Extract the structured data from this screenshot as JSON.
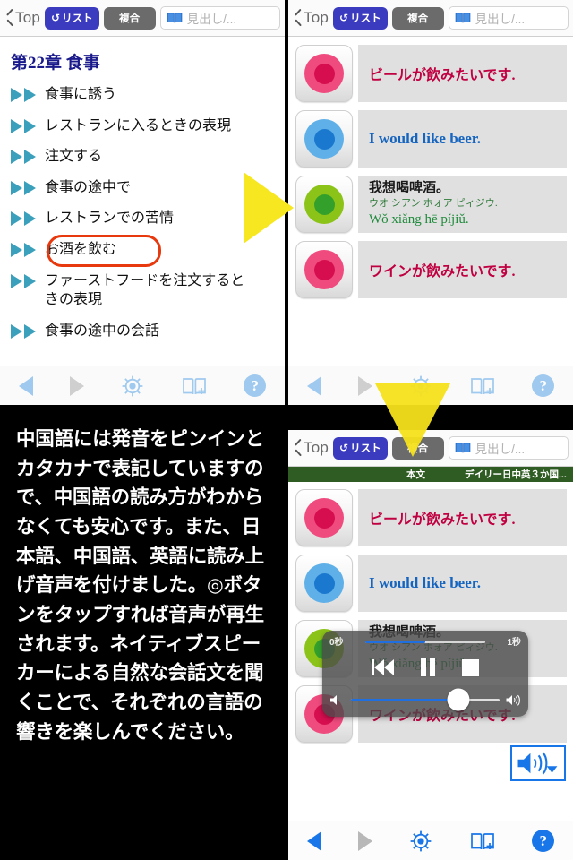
{
  "navbar": {
    "back_label": "Top",
    "list_button": "リスト",
    "list_icon": "loop-arrow-icon",
    "compound_button": "複合",
    "search_placeholder": "見出し/...",
    "search_icon": "open-book-icon",
    "back_icon": "chevron-left-icon"
  },
  "toc": {
    "title": "第22章 食事",
    "items": [
      {
        "label": "食事に誘う",
        "highlighted": false
      },
      {
        "label": "レストランに入るときの表現",
        "highlighted": false
      },
      {
        "label": "注文する",
        "highlighted": false
      },
      {
        "label": "食事の途中で",
        "highlighted": false
      },
      {
        "label": "レストランでの苦情",
        "highlighted": false
      },
      {
        "label": "お酒を飲む",
        "highlighted": true
      },
      {
        "label": "ファーストフードを注文すると\nきの表現",
        "highlighted": false
      },
      {
        "label": "食事の途中の会話",
        "highlighted": false
      }
    ],
    "highlight_color": "#e8380d"
  },
  "toolbar": {
    "back_icon": "back-triangle-icon",
    "forward_icon": "forward-triangle-icon",
    "wheel_icon": "ship-wheel-icon",
    "bookmark_icon": "book-plus-icon",
    "help_icon": "question-mark-icon",
    "help_label": "?"
  },
  "sentences": [
    {
      "button_icon": "play-audio-pink-icon",
      "color": "pink",
      "lang": "ja",
      "text": "ビールが飲みたいです."
    },
    {
      "button_icon": "play-audio-blue-icon",
      "color": "blue",
      "lang": "en",
      "text": "I would like beer."
    },
    {
      "button_icon": "play-audio-green-icon",
      "color": "green",
      "lang": "zh",
      "han": "我想喝啤酒。",
      "katakana": "ウオ シアン ホォア ピィジウ.",
      "pinyin": "Wǒ xiǎng hē píjiǔ."
    },
    {
      "button_icon": "play-audio-pink-icon",
      "color": "pink",
      "lang": "ja",
      "text": "ワインが飲みたいです."
    }
  ],
  "ribbon": {
    "section": "本文",
    "title": "デイリー日中英３か国..."
  },
  "audio_player": {
    "elapsed": "0秒",
    "remaining": "1秒",
    "progress_percent": 50,
    "volume_percent": 72,
    "rewind_icon": "rewind-icon",
    "pause_icon": "pause-icon",
    "stop_icon": "stop-icon",
    "volume_low_icon": "speaker-low-icon",
    "volume_high_icon": "speaker-high-icon"
  },
  "speaker_badge": {
    "icon": "speaker-wave-icon",
    "dropdown_icon": "chevron-down-icon"
  },
  "caption": {
    "text": "中国語には発音をピンインとカタカナで表記していますので、中国語の読み方がわからなくても安心です。また、日本語、中国語、英語に読み上げ音声を付けました。◎ボタンをタップすれば音声が再生されます。ネイティブスピーカーによる自然な会話文を聞くことで、それぞれの言語の響きを楽しんでください。"
  },
  "annotations": {
    "arrow_right_color": "#f7e720",
    "arrow_down_color": "#f5e21c",
    "cursor_color": "#000000"
  }
}
